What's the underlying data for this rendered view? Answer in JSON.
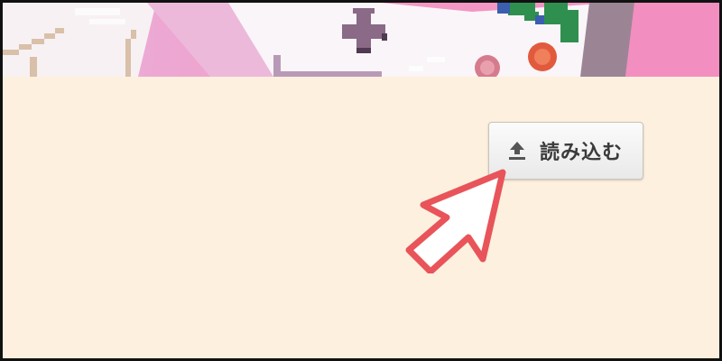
{
  "toolbar": {
    "load_label": "読み込む",
    "load_icon": "upload-icon"
  },
  "colors": {
    "panel_background": "#fdf0de",
    "button_text": "#3a3a3a",
    "pointer_arrow": "#e8545a",
    "banner_pink": "#f08ec4"
  }
}
